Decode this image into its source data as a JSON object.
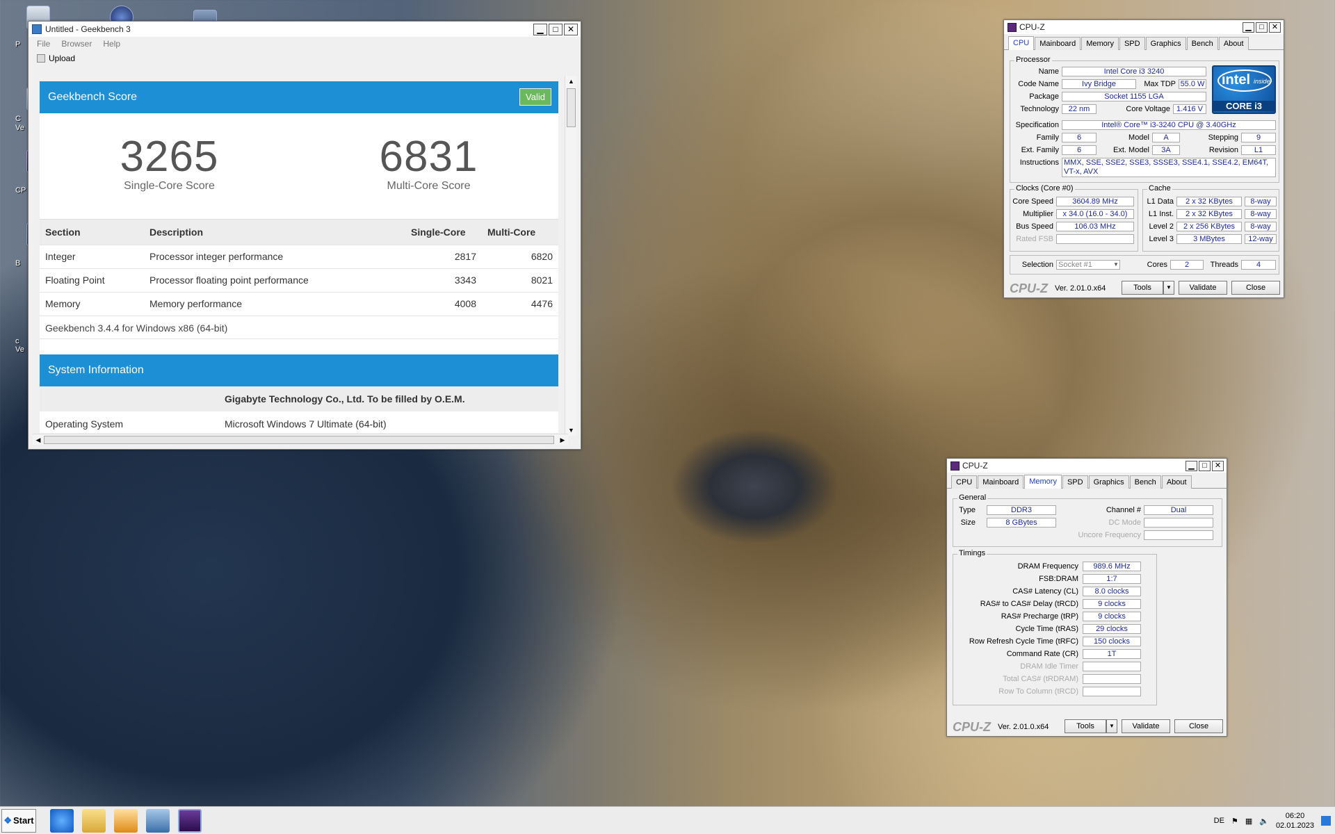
{
  "desktop": {
    "labels": [
      "P",
      "C",
      "Ve",
      "CP",
      "B",
      "c",
      "Ve"
    ]
  },
  "geekbench": {
    "title": "Untitled - Geekbench 3",
    "menu": [
      "File",
      "Browser",
      "Help"
    ],
    "upload_label": "Upload",
    "score_header": "Geekbench Score",
    "valid_badge": "Valid",
    "single_score": "3265",
    "single_label": "Single-Core Score",
    "multi_score": "6831",
    "multi_label": "Multi-Core Score",
    "table_headers": [
      "Section",
      "Description",
      "Single-Core",
      "Multi-Core"
    ],
    "rows": [
      {
        "section": "Integer",
        "description": "Processor integer performance",
        "single": "2817",
        "multi": "6820"
      },
      {
        "section": "Floating Point",
        "description": "Processor floating point performance",
        "single": "3343",
        "multi": "8021"
      },
      {
        "section": "Memory",
        "description": "Memory performance",
        "single": "4008",
        "multi": "4476"
      }
    ],
    "version_line": "Geekbench 3.4.4 for Windows x86 (64-bit)",
    "sysinfo_header": "System Information",
    "sys_vendor": "Gigabyte Technology Co., Ltd. To be filled by O.E.M.",
    "os_label": "Operating System",
    "os_value": "Microsoft Windows 7 Ultimate (64-bit)"
  },
  "cpuz1": {
    "title": "CPU-Z",
    "tabs": [
      "CPU",
      "Mainboard",
      "Memory",
      "SPD",
      "Graphics",
      "Bench",
      "About"
    ],
    "processor_group": "Processor",
    "name_l": "Name",
    "name": "Intel Core i3 3240",
    "codename_l": "Code Name",
    "codename": "Ivy Bridge",
    "maxtdp_l": "Max TDP",
    "maxtdp": "55.0 W",
    "package_l": "Package",
    "package": "Socket 1155 LGA",
    "tech_l": "Technology",
    "tech": "22 nm",
    "cvolt_l": "Core Voltage",
    "cvolt": "1.416 V",
    "spec_l": "Specification",
    "spec": "Intel® Core™ i3-3240 CPU @ 3.40GHz",
    "family_l": "Family",
    "family": "6",
    "model_l": "Model",
    "model": "A",
    "stepping_l": "Stepping",
    "stepping": "9",
    "extfam_l": "Ext. Family",
    "extfam": "6",
    "extmodel_l": "Ext. Model",
    "extmodel": "3A",
    "revision_l": "Revision",
    "revision": "L1",
    "instr_l": "Instructions",
    "instr": "MMX, SSE, SSE2, SSE3, SSSE3, SSE4.1, SSE4.2, EM64T, VT-x, AVX",
    "clocks_group": "Clocks (Core #0)",
    "corespeed_l": "Core Speed",
    "corespeed": "3604.89 MHz",
    "mult_l": "Multiplier",
    "mult": "x 34.0 (16.0 - 34.0)",
    "bus_l": "Bus Speed",
    "bus": "106.03 MHz",
    "fsb_l": "Rated FSB",
    "cache_group": "Cache",
    "l1d_l": "L1 Data",
    "l1d": "2 x 32 KBytes",
    "l1d_w": "8-way",
    "l1i_l": "L1 Inst.",
    "l1i": "2 x 32 KBytes",
    "l1i_w": "8-way",
    "l2_l": "Level 2",
    "l2": "2 x 256 KBytes",
    "l2_w": "8-way",
    "l3_l": "Level 3",
    "l3": "3 MBytes",
    "l3_w": "12-way",
    "sel_l": "Selection",
    "sel": "Socket #1",
    "cores_l": "Cores",
    "cores": "2",
    "threads_l": "Threads",
    "threads": "4",
    "logo": "CPU-Z",
    "version": "Ver. 2.01.0.x64",
    "tools": "Tools",
    "validate": "Validate",
    "close": "Close",
    "intel_brand": "intel",
    "intel_inside": "inside",
    "intel_core": "CORE i3"
  },
  "cpuz2": {
    "title": "CPU-Z",
    "tabs": [
      "CPU",
      "Mainboard",
      "Memory",
      "SPD",
      "Graphics",
      "Bench",
      "About"
    ],
    "general_group": "General",
    "type_l": "Type",
    "type": "DDR3",
    "channel_l": "Channel #",
    "channel": "Dual",
    "size_l": "Size",
    "size": "8 GBytes",
    "dcmode_l": "DC Mode",
    "uncore_l": "Uncore Frequency",
    "timings_group": "Timings",
    "timings": [
      {
        "label": "DRAM Frequency",
        "value": "989.6 MHz"
      },
      {
        "label": "FSB:DRAM",
        "value": "1:7"
      },
      {
        "label": "CAS# Latency (CL)",
        "value": "8.0 clocks"
      },
      {
        "label": "RAS# to CAS# Delay (tRCD)",
        "value": "9 clocks"
      },
      {
        "label": "RAS# Precharge (tRP)",
        "value": "9 clocks"
      },
      {
        "label": "Cycle Time (tRAS)",
        "value": "29 clocks"
      },
      {
        "label": "Row Refresh Cycle Time (tRFC)",
        "value": "150 clocks"
      },
      {
        "label": "Command Rate (CR)",
        "value": "1T"
      }
    ],
    "dim_timings": [
      "DRAM Idle Timer",
      "Total CAS# (tRDRAM)",
      "Row To Column (tRCD)"
    ],
    "logo": "CPU-Z",
    "version": "Ver. 2.01.0.x64",
    "tools": "Tools",
    "validate": "Validate",
    "close": "Close"
  },
  "taskbar": {
    "start": "Start",
    "lang": "DE",
    "time": "06:20",
    "date": "02.01.2023"
  }
}
